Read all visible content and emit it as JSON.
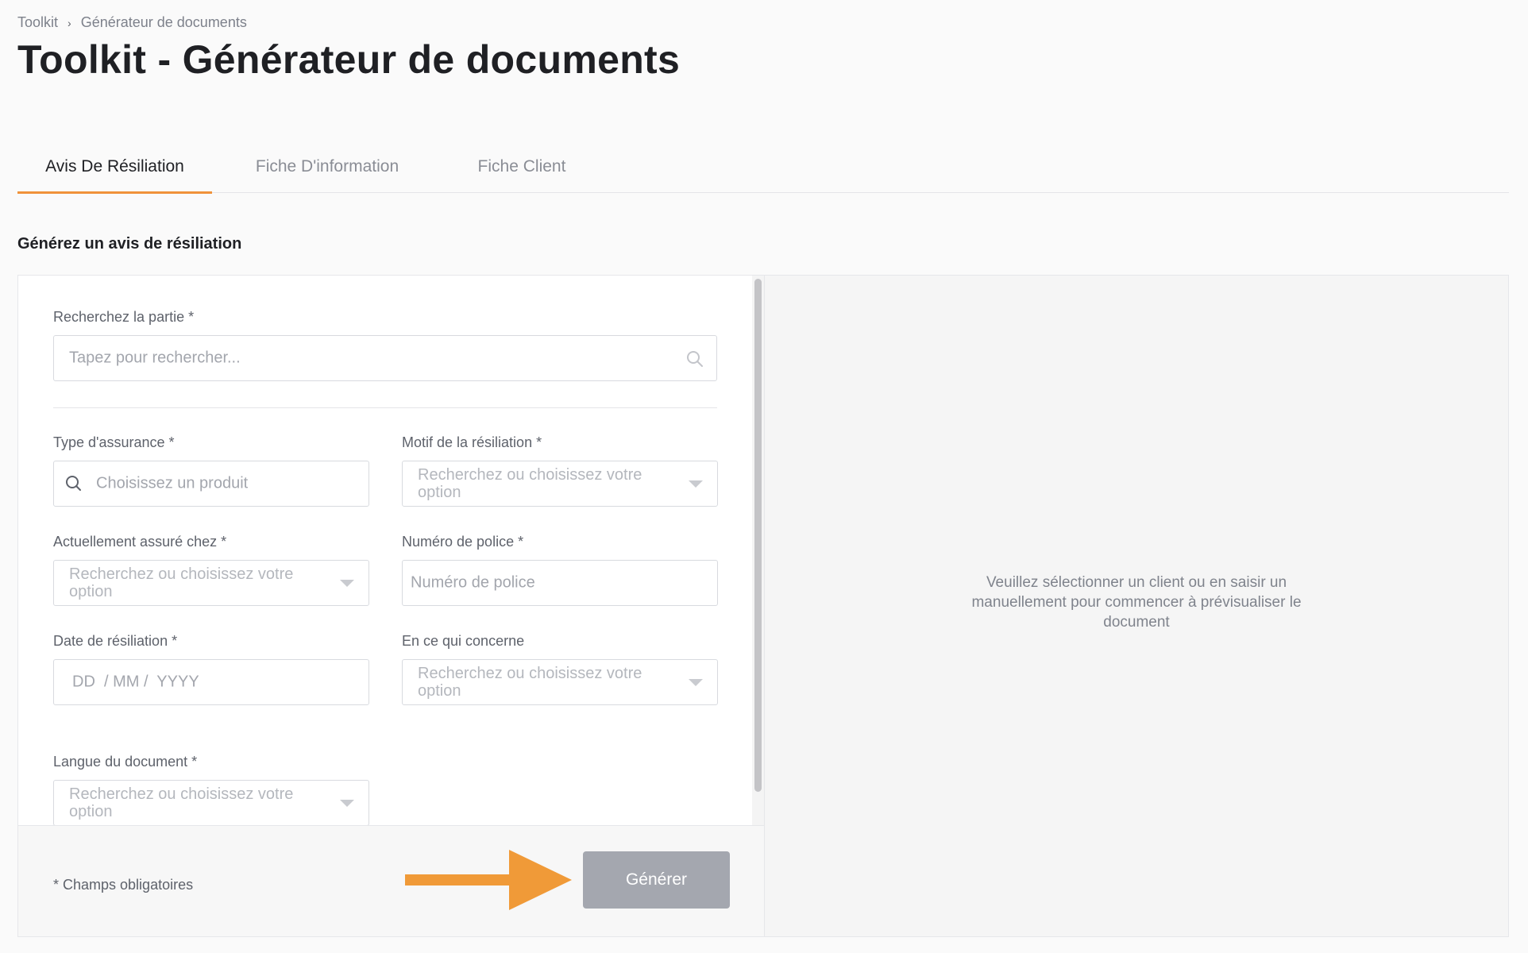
{
  "breadcrumb": {
    "root": "Toolkit",
    "current": "Générateur de documents"
  },
  "page": {
    "title": "Toolkit - Générateur de documents",
    "section_title": "Générez un avis de résiliation"
  },
  "tabs": [
    {
      "label": "Avis De Résiliation",
      "active": true
    },
    {
      "label": "Fiche D'information",
      "active": false
    },
    {
      "label": "Fiche Client",
      "active": false
    }
  ],
  "form": {
    "party": {
      "label": "Recherchez la partie *",
      "placeholder": "Tapez pour rechercher..."
    },
    "insurance_type": {
      "label": "Type d'assurance *",
      "placeholder": "Choisissez un produit"
    },
    "termination_reason": {
      "label": "Motif de la résiliation *",
      "placeholder": "Recherchez ou choisissez votre option"
    },
    "current_insurer": {
      "label": "Actuellement assuré chez *",
      "placeholder": "Recherchez ou choisissez votre option"
    },
    "policy_number": {
      "label": "Numéro de police *",
      "placeholder": "Numéro de police"
    },
    "termination_date": {
      "label": "Date de résiliation *",
      "placeholder": "DD  / MM /  YYYY"
    },
    "regarding": {
      "label": "En ce qui concerne",
      "placeholder": "Recherchez ou choisissez votre option"
    },
    "document_language": {
      "label": "Langue du document *",
      "placeholder": "Recherchez ou choisissez votre option"
    }
  },
  "footer": {
    "required_note": "* Champs obligatoires",
    "generate_label": "Générer"
  },
  "preview": {
    "message": "Veuillez sélectionner un client ou en saisir un manuellement pour commencer à prévisualiser le document"
  },
  "colors": {
    "accent": "#f0923a",
    "button_disabled": "#a4a7af",
    "arrow": "#f09a38"
  }
}
